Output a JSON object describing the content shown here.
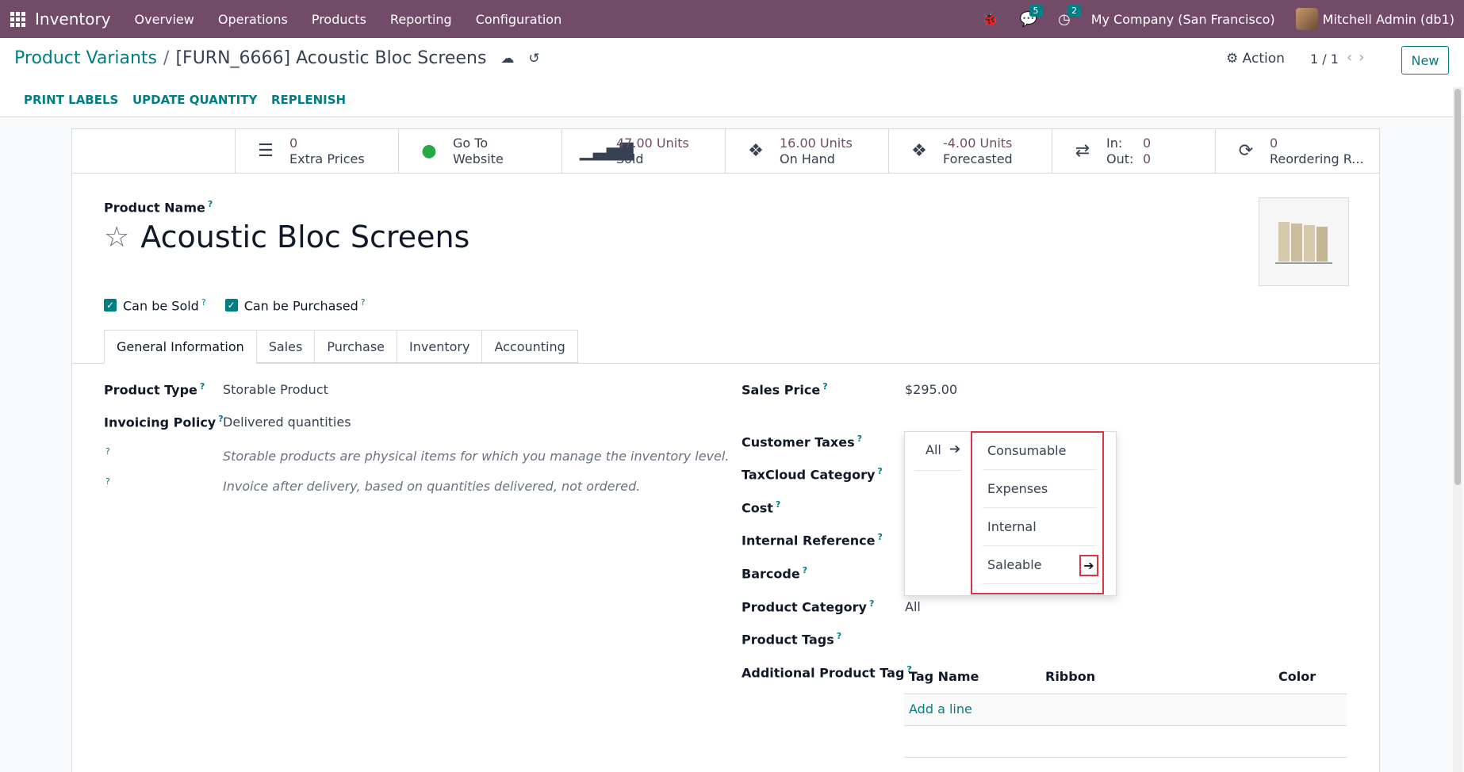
{
  "nav": {
    "brand": "Inventory",
    "items": [
      "Overview",
      "Operations",
      "Products",
      "Reporting",
      "Configuration"
    ],
    "messages_count": "5",
    "activities_count": "2",
    "company": "My Company (San Francisco)",
    "user": "Mitchell Admin (db1)"
  },
  "control": {
    "breadcrumb_parent": "Product Variants",
    "breadcrumb_current": "[FURN_6666] Acoustic Bloc Screens",
    "action_label": "Action",
    "pager": "1 / 1",
    "new_label": "New"
  },
  "buttons": {
    "print_labels": "PRINT LABELS",
    "update_quantity": "UPDATE QUANTITY",
    "replenish": "REPLENISH"
  },
  "smart_buttons": {
    "extra_prices": {
      "value": "0",
      "label": "Extra Prices"
    },
    "website": {
      "value": "Go To",
      "label": "Website"
    },
    "sold": {
      "value": "47.00 Units",
      "label": "Sold"
    },
    "on_hand": {
      "value": "16.00 Units",
      "label": "On Hand"
    },
    "forecasted": {
      "value": "-4.00 Units",
      "label": "Forecasted"
    },
    "in_out": {
      "in_label": "In:",
      "in_value": "0",
      "out_label": "Out:",
      "out_value": "0"
    },
    "reordering": {
      "value": "0",
      "label": "Reordering R..."
    }
  },
  "product": {
    "name_label": "Product Name",
    "name": "Acoustic Bloc Screens",
    "can_be_sold": "Can be Sold",
    "can_be_purchased": "Can be Purchased"
  },
  "tabs": [
    "General Information",
    "Sales",
    "Purchase",
    "Inventory",
    "Accounting"
  ],
  "general": {
    "product_type_label": "Product Type",
    "product_type": "Storable Product",
    "invoicing_policy_label": "Invoicing Policy",
    "invoicing_policy": "Delivered quantities",
    "help_type": "Storable products are physical items for which you manage the inventory level.",
    "help_invoice": "Invoice after delivery, based on quantities delivered, not ordered.",
    "sales_price_label": "Sales Price",
    "sales_price": "$295.00",
    "customer_taxes_label": "Customer Taxes",
    "taxcloud_label": "TaxCloud Category",
    "cost_label": "Cost",
    "internal_ref_label": "Internal Reference",
    "barcode_label": "Barcode",
    "product_category_label": "Product Category",
    "product_category": "All",
    "product_tags_label": "Product Tags",
    "additional_tag_label": "Additional Product Tag"
  },
  "category_dropdown": {
    "parent": "All",
    "items": [
      "Consumable",
      "Expenses",
      "Internal",
      "Saleable"
    ]
  },
  "tag_table": {
    "headers": [
      "Tag Name",
      "Ribbon",
      "Color"
    ],
    "add_line": "Add a line"
  }
}
